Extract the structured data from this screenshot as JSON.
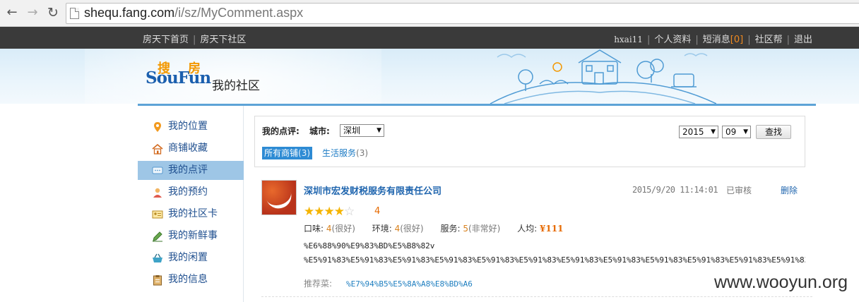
{
  "browser": {
    "back_icon": "arrow-left-icon",
    "forward_icon": "arrow-right-icon",
    "reload_icon": "reload-icon",
    "url_host": "shequ.fang.com",
    "url_path": "/i/sz/MyComment.aspx"
  },
  "topbar": {
    "left_links": [
      "房天下首页",
      "房天下社区"
    ],
    "username": "hxai11",
    "profile": "个人资料",
    "messages": "短消息",
    "message_count": "[0]",
    "help": "社区帮",
    "logout": "退出"
  },
  "header": {
    "logo_text": "SouFun",
    "logo_cn_1": "搜",
    "logo_cn_2": "房",
    "title": "我的社区"
  },
  "sidebar": {
    "items": [
      {
        "label": "我的位置",
        "icon": "location-pin-icon"
      },
      {
        "label": "商铺收藏",
        "icon": "house-icon"
      },
      {
        "label": "我的点评",
        "icon": "comment-icon",
        "active": true
      },
      {
        "label": "我的预约",
        "icon": "person-icon"
      },
      {
        "label": "我的社区卡",
        "icon": "id-card-icon"
      },
      {
        "label": "我的新鲜事",
        "icon": "pencil-icon"
      },
      {
        "label": "我的闲置",
        "icon": "basket-icon"
      },
      {
        "label": "我的信息",
        "icon": "clipboard-icon"
      }
    ]
  },
  "filter": {
    "my_reviews_label": "我的点评:",
    "city_label": "城市:",
    "city_value": "深圳",
    "year_value": "2015",
    "month_value": "09",
    "search_label": "查找",
    "tab_all": "所有商铺",
    "tab_all_count": "(3)",
    "tab_life": "生活服务",
    "tab_life_count": "(3)"
  },
  "review": {
    "shop_name": "深圳市宏发财税服务有限责任公司",
    "date": "2015/9/20 11:14:01",
    "status": "已审核",
    "delete": "删除",
    "stars_filled": 4,
    "stars_total": 5,
    "score": "4",
    "taste_label": "口味:",
    "taste_value": "4",
    "taste_desc": "(很好)",
    "env_label": "环境:",
    "env_value": "4",
    "env_desc": "(很好)",
    "service_label": "服务:",
    "service_value": "5",
    "service_desc": "(非常好)",
    "avg_label": "人均:",
    "avg_value": "¥111",
    "content_line1": "%E6%88%90%E9%83%BD%E5%B8%82v",
    "content_line2": "%E5%91%83%E5%91%83%E5%91%83%E5%91%83%E5%91%83%E5%91%83%E5%91%83%E5%91%83%E5%91%83%E5%91%83%E5%91%83%E5%91%83",
    "recommend_label": "推荐菜:",
    "recommend_value": "%E7%94%B5%E5%8A%A8%E8%BD%A6"
  },
  "watermark": "www.wooyun.org",
  "colors": {
    "topbar_bg": "#3a3a3a",
    "accent_blue": "#2e8bd4",
    "link_blue": "#1f65ae",
    "orange": "#e66a00",
    "star": "#f5b400",
    "active_nav": "#9ec6e6"
  }
}
